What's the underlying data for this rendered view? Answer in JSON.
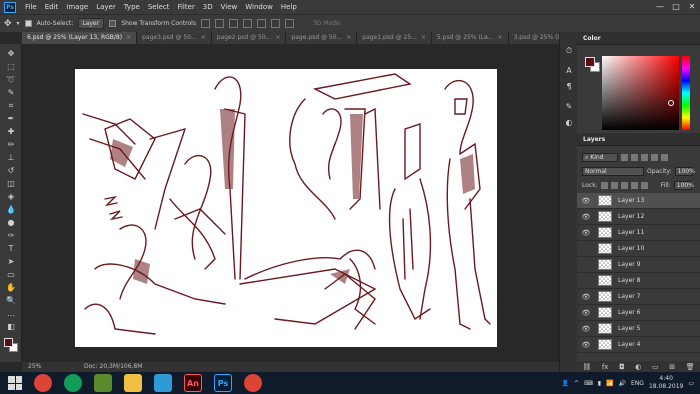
{
  "app": {
    "logo": "Ps"
  },
  "menu": [
    "File",
    "Edit",
    "Image",
    "Layer",
    "Type",
    "Select",
    "Filter",
    "3D",
    "View",
    "Window",
    "Help"
  ],
  "window_controls": [
    "—",
    "□",
    "✕"
  ],
  "options": {
    "auto_select_label": "Auto-Select:",
    "auto_select_checked": true,
    "auto_select_target": "Layer",
    "transform_label": "Show Transform Controls",
    "mode_3d_label": "3D Mode:"
  },
  "tabs": [
    {
      "label": "6.psd @ 25% (Layer 13, RGB/8)",
      "active": true
    },
    {
      "label": "page3.psd @ 50...",
      "active": false
    },
    {
      "label": "page2.psd @ 50...",
      "active": false
    },
    {
      "label": "page.psd @ 50...",
      "active": false
    },
    {
      "label": "page1.psd @ 25...",
      "active": false
    },
    {
      "label": "5.psd @ 25% (La...",
      "active": false
    },
    {
      "label": "3.psd @ 25% (La...",
      "active": false
    }
  ],
  "status": {
    "zoom": "25%",
    "doc": "Doc: 20,3M/106,8M"
  },
  "color_panel": {
    "title": "Color",
    "foreground": "#5a0f14",
    "background": "#ffffff"
  },
  "layers_panel": {
    "title": "Layers",
    "filter_label": "Kind",
    "blend_mode": "Normal",
    "opacity_label": "Opacity:",
    "opacity_value": "100%",
    "lock_label": "Lock:",
    "fill_label": "Fill:",
    "fill_value": "100%",
    "layers": [
      {
        "name": "Layer 13",
        "visible": true,
        "selected": true
      },
      {
        "name": "Layer 12",
        "visible": true,
        "selected": false
      },
      {
        "name": "Layer 11",
        "visible": true,
        "selected": false
      },
      {
        "name": "Layer 10",
        "visible": false,
        "selected": false
      },
      {
        "name": "Layer 9",
        "visible": false,
        "selected": false
      },
      {
        "name": "Layer 8",
        "visible": false,
        "selected": false
      },
      {
        "name": "Layer 7",
        "visible": true,
        "selected": false
      },
      {
        "name": "Layer 6",
        "visible": true,
        "selected": false
      },
      {
        "name": "Layer 5",
        "visible": true,
        "selected": false
      },
      {
        "name": "Layer 4",
        "visible": true,
        "selected": false
      }
    ]
  },
  "taskbar": {
    "apps": [
      {
        "name": "chrome",
        "label": "",
        "color": "#db4437"
      },
      {
        "name": "chrome-2",
        "label": "",
        "color": "#0f9d58"
      },
      {
        "name": "game",
        "label": "",
        "color": "#5a8a2a"
      },
      {
        "name": "explorer",
        "label": "",
        "color": "#f0c040"
      },
      {
        "name": "paint-app",
        "label": "",
        "color": "#2e9bd6"
      },
      {
        "name": "animate",
        "label": "An",
        "color": "#3a0000"
      },
      {
        "name": "photoshop",
        "label": "Ps",
        "color": "#001e36"
      },
      {
        "name": "chrome-3",
        "label": "",
        "color": "#db4437"
      }
    ],
    "language": "ENG",
    "time": "4:40",
    "date": "18.08.2019"
  }
}
